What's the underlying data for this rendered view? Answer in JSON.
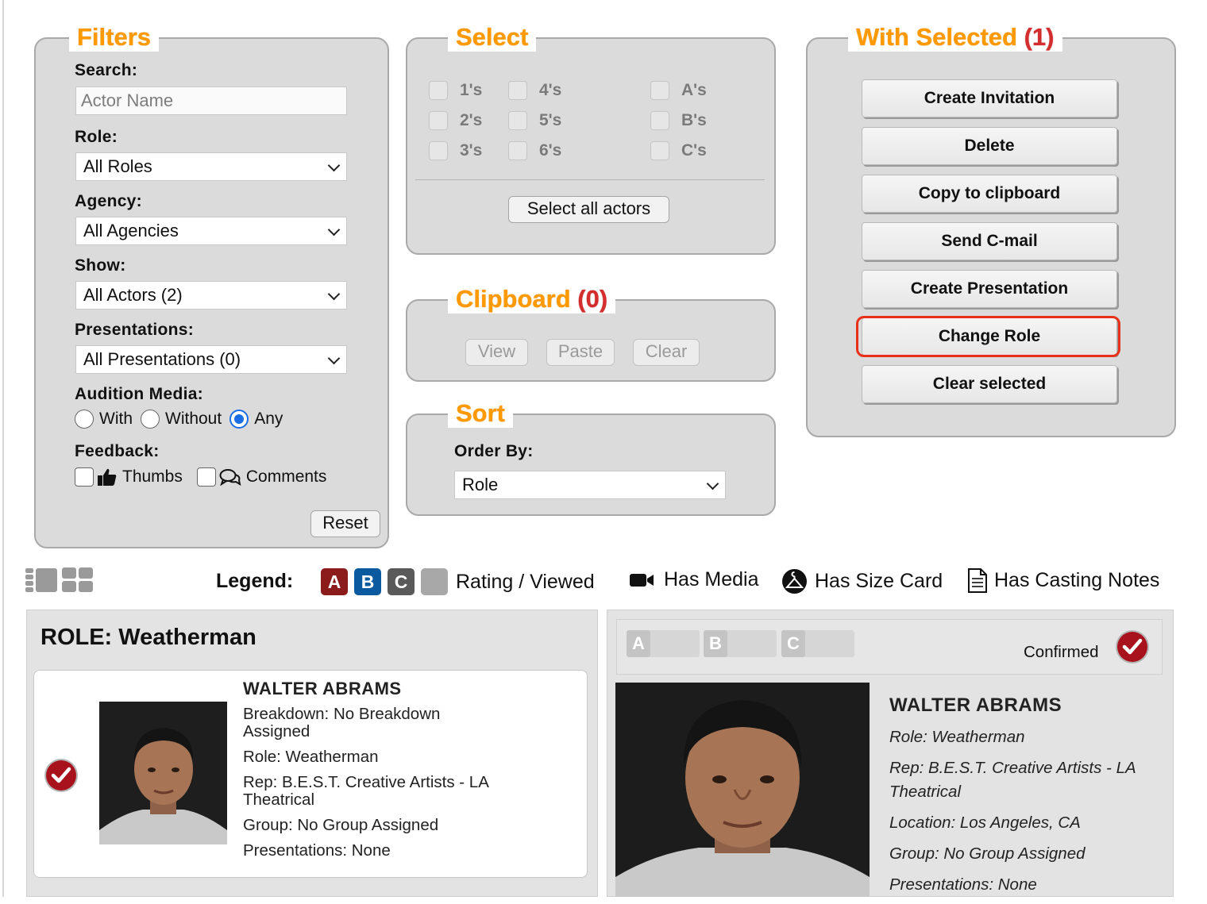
{
  "filters": {
    "title": "Filters",
    "search_label": "Search:",
    "search_placeholder": "Actor Name",
    "role_label": "Role:",
    "role_value": "All Roles",
    "agency_label": "Agency:",
    "agency_value": "All Agencies",
    "show_label": "Show:",
    "show_value": "All Actors (2)",
    "presentations_label": "Presentations:",
    "presentations_value": "All Presentations (0)",
    "audition_label": "Audition Media:",
    "audition_options": [
      "With",
      "Without",
      "Any"
    ],
    "audition_selected": "Any",
    "feedback_label": "Feedback:",
    "feedback_thumbs": "Thumbs",
    "feedback_comments": "Comments",
    "reset_label": "Reset"
  },
  "select": {
    "title": "Select",
    "options": [
      "1's",
      "2's",
      "3's",
      "4's",
      "5's",
      "6's",
      "A's",
      "B's",
      "C's"
    ],
    "select_all_label": "Select all actors"
  },
  "clipboard": {
    "title": "Clipboard",
    "count": "(0)",
    "view_label": "View",
    "paste_label": "Paste",
    "clear_label": "Clear"
  },
  "sort": {
    "title": "Sort",
    "order_label": "Order By:",
    "order_value": "Role"
  },
  "with_selected": {
    "title": "With Selected",
    "count": "(1)",
    "actions": [
      "Create Invitation",
      "Delete",
      "Copy to clipboard",
      "Send C-mail",
      "Create Presentation",
      "Change Role",
      "Clear selected"
    ],
    "highlighted": "Change Role"
  },
  "legend": {
    "label": "Legend:",
    "badges": [
      "A",
      "B",
      "C"
    ],
    "badge_colors": [
      "#8c1c1c",
      "#0b5aa0",
      "#5a5a5a",
      "#a8a8a8"
    ],
    "rating_text": "Rating / Viewed",
    "media_text": "Has Media",
    "size_card_text": "Has Size Card",
    "casting_notes_text": "Has Casting Notes"
  },
  "role_card": {
    "title": "ROLE: Weatherman",
    "actor_name": "WALTER ABRAMS",
    "breakdown": "Breakdown: No Breakdown Assigned",
    "role": "Role: Weatherman",
    "rep": "Rep: B.E.S.T. Creative Artists - LA Theatrical",
    "group": "Group: No Group Assigned",
    "presentations": "Presentations: None"
  },
  "detail": {
    "ratings": [
      "A",
      "B",
      "C"
    ],
    "status": "Confirmed",
    "actor_name": "WALTER ABRAMS",
    "role": "Role: Weatherman",
    "rep": "Rep: B.E.S.T. Creative Artists - LA Theatrical",
    "location": "Location: Los Angeles, CA",
    "group": "Group: No Group Assigned",
    "presentations": "Presentations: None"
  }
}
